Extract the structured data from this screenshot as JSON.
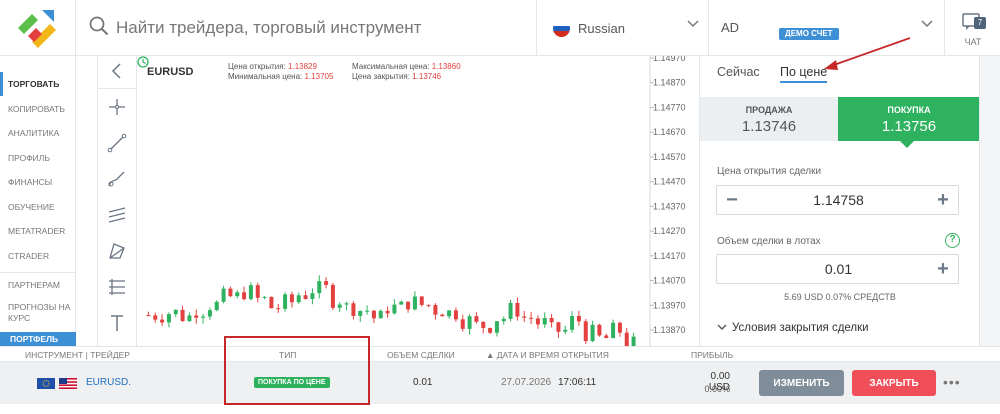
{
  "header": {
    "search_placeholder": "Найти трейдера, торговый инструмент",
    "language": "Russian",
    "account_name": "AD",
    "account_badge": "ДЕМО СЧЕТ",
    "chat_label": "ЧАТ",
    "chat_count": "7"
  },
  "nav": {
    "items": [
      "ТОРГОВАТЬ",
      "КОПИРОВАТЬ",
      "АНАЛИТИКА",
      "ПРОФИЛЬ",
      "ФИНАНСЫ",
      "ОБУЧЕНИЕ",
      "METATRADER",
      "CTRADER"
    ],
    "partners": "ПАРТНЕРАМ",
    "forecasts": "ПРОГНОЗЫ НА КУРС",
    "portfolio": "ПОРТФЕЛЬ"
  },
  "chart_info": {
    "symbol": "EURUSD",
    "open_label": "Цена открытия:",
    "open_value": "1.13829",
    "min_label": "Минимальная цена:",
    "min_value": "1.13705",
    "max_label": "Максимальная цена:",
    "max_value": "1.13860",
    "close_label": "Цена закрытия:",
    "close_value": "1.13746"
  },
  "chart_data": {
    "type": "candlestick",
    "y_ticks": [
      "1.14970",
      "1.14870",
      "1.14770",
      "1.14670",
      "1.14570",
      "1.14470",
      "1.14370",
      "1.14270",
      "1.14170",
      "1.14070",
      "1.13970",
      "1.13870"
    ],
    "colors": {
      "up": "#2fb25f",
      "down": "#e2413f"
    }
  },
  "order_panel": {
    "tab_now": "Сейчас",
    "tab_price": "По цене",
    "sell_label": "ПРОДАЖА",
    "sell_price": "1.13746",
    "buy_label": "ПОКУПКА",
    "buy_price": "1.13756",
    "open_price_label": "Цена открытия сделки",
    "open_price_value": "1.14758",
    "volume_label": "Объем сделки в лотах",
    "volume_value": "0.01",
    "funds_text": "5.69 USD  0.07% СРЕДСТВ",
    "close_conditions": "Условия закрытия сделки"
  },
  "table": {
    "headers": {
      "instrument": "ИНСТРУМЕНТ | ТРЕЙДЕР",
      "type": "ТИП",
      "volume": "ОБЪЕМ СДЕЛКИ",
      "datetime": "ДАТА И ВРЕМЯ ОТКРЫТИЯ",
      "profit": "ПРИБЫЛЬ"
    },
    "row": {
      "instrument": "EURUSD.",
      "type": "ПОКУПКА ПО ЦЕНЕ",
      "volume": "0.01",
      "date": "27.07.2026",
      "time": "17:06:11",
      "profit": "0.00 USD",
      "profit_pct": "0.00%",
      "edit_button": "ИЗМЕНИТЬ",
      "close_button": "ЗАКРЫТЬ"
    }
  }
}
